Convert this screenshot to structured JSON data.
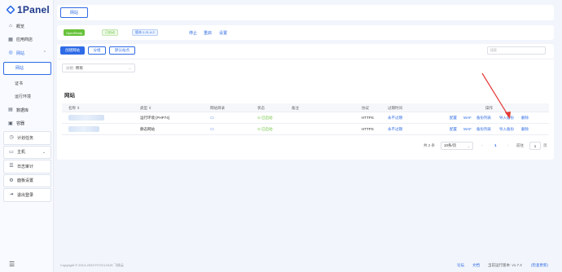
{
  "app": {
    "logo_text": "1Panel"
  },
  "sidebar": {
    "items": [
      {
        "label": "概览",
        "icon": "home-icon"
      },
      {
        "label": "应用商店",
        "icon": "grid-icon"
      },
      {
        "label": "网站",
        "icon": "globe-icon",
        "expanded": true
      },
      {
        "label": "网站",
        "sub": true,
        "active": true
      },
      {
        "label": "证书",
        "sub": true
      },
      {
        "label": "运行环境",
        "sub": true
      },
      {
        "label": "数据库",
        "icon": "database-icon"
      },
      {
        "label": "容器",
        "icon": "container-icon"
      },
      {
        "label": "计划任务",
        "icon": "clock-icon"
      },
      {
        "label": "主机",
        "icon": "host-icon"
      },
      {
        "label": "日志审计",
        "icon": "log-icon"
      },
      {
        "label": "面板设置",
        "icon": "settings-icon"
      },
      {
        "label": "退出登录",
        "icon": "logout-icon"
      }
    ]
  },
  "tabs": {
    "active_label": "网站"
  },
  "status": {
    "app_badge": "OpenResty",
    "run_badge": "已启动",
    "version_badge": "版本:1.21.4.2",
    "actions": [
      "停止",
      "重启",
      "设置"
    ]
  },
  "toolbar": {
    "create_label": "创建网站",
    "group_label": "分组",
    "default_site_label": "默认站点",
    "search_placeholder": "搜索"
  },
  "filter": {
    "label": "分组",
    "value": "所有"
  },
  "table": {
    "title": "网站",
    "columns": [
      "名称 ⇕",
      "类型 ⇕",
      "网站目录",
      "状态",
      "备注",
      "协议",
      "过期时间",
      "操作"
    ],
    "rows": [
      {
        "type": "运行环境 [PHP74]",
        "status": "已启动",
        "protocol": "HTTPS",
        "expire": "永不过期",
        "actions": [
          "配置",
          "WAF",
          "备份列表",
          "导入备份",
          "删除"
        ]
      },
      {
        "type": "静态网站",
        "status": "已启动",
        "protocol": "HTTPS",
        "expire": "永不过期",
        "actions": [
          "配置",
          "WAF",
          "备份列表",
          "导入备份",
          "删除"
        ]
      }
    ]
  },
  "pagination": {
    "total": "共 2 条",
    "page_size": "10条/页",
    "prev": "‹",
    "current": "1",
    "next": "›",
    "goto_label": "前往",
    "goto_value": "1",
    "page_suffix": "页"
  },
  "footer": {
    "copyright": "Copyright © 2014-2023 FIT2CLOUD 飞致云",
    "forum": "论坛",
    "docs": "文档",
    "version_label": "当前运行版本: v1.7.4",
    "check_update": "(检查更新)"
  },
  "colors": {
    "accent": "#2e6be6",
    "success": "#67c23a",
    "annotation": "#e53935"
  }
}
